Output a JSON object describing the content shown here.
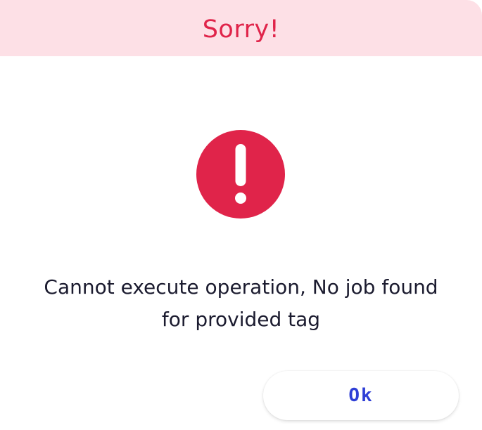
{
  "dialog": {
    "title": "Sorry!",
    "icon": "exclamation-circle-icon",
    "message": "Cannot execute operation, No job found for provided tag",
    "ok_label": "Ok"
  },
  "colors": {
    "header_background": "#fde0e6",
    "title": "#e0244a",
    "icon": "#e0244a",
    "message_text": "#1b1b2f",
    "button_text": "#2f3fd6"
  }
}
